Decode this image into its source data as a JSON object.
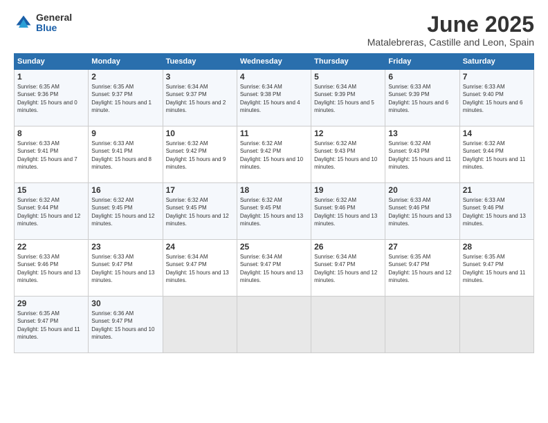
{
  "header": {
    "logo_general": "General",
    "logo_blue": "Blue",
    "title": "June 2025",
    "subtitle": "Matalebreras, Castille and Leon, Spain"
  },
  "calendar": {
    "days_of_week": [
      "Sunday",
      "Monday",
      "Tuesday",
      "Wednesday",
      "Thursday",
      "Friday",
      "Saturday"
    ],
    "weeks": [
      [
        null,
        null,
        null,
        null,
        null,
        null,
        {
          "day": 1,
          "sunrise": "6:35 AM",
          "sunset": "9:36 PM",
          "daylight": "15 hours and 0 minutes."
        },
        {
          "day": 2,
          "sunrise": "6:35 AM",
          "sunset": "9:37 PM",
          "daylight": "15 hours and 1 minute."
        },
        {
          "day": 3,
          "sunrise": "6:34 AM",
          "sunset": "9:37 PM",
          "daylight": "15 hours and 2 minutes."
        },
        {
          "day": 4,
          "sunrise": "6:34 AM",
          "sunset": "9:38 PM",
          "daylight": "15 hours and 4 minutes."
        },
        {
          "day": 5,
          "sunrise": "6:34 AM",
          "sunset": "9:39 PM",
          "daylight": "15 hours and 5 minutes."
        },
        {
          "day": 6,
          "sunrise": "6:33 AM",
          "sunset": "9:39 PM",
          "daylight": "15 hours and 6 minutes."
        },
        {
          "day": 7,
          "sunrise": "6:33 AM",
          "sunset": "9:40 PM",
          "daylight": "15 hours and 6 minutes."
        }
      ],
      [
        {
          "day": 8,
          "sunrise": "6:33 AM",
          "sunset": "9:41 PM",
          "daylight": "15 hours and 7 minutes."
        },
        {
          "day": 9,
          "sunrise": "6:33 AM",
          "sunset": "9:41 PM",
          "daylight": "15 hours and 8 minutes."
        },
        {
          "day": 10,
          "sunrise": "6:32 AM",
          "sunset": "9:42 PM",
          "daylight": "15 hours and 9 minutes."
        },
        {
          "day": 11,
          "sunrise": "6:32 AM",
          "sunset": "9:42 PM",
          "daylight": "15 hours and 10 minutes."
        },
        {
          "day": 12,
          "sunrise": "6:32 AM",
          "sunset": "9:43 PM",
          "daylight": "15 hours and 10 minutes."
        },
        {
          "day": 13,
          "sunrise": "6:32 AM",
          "sunset": "9:43 PM",
          "daylight": "15 hours and 11 minutes."
        },
        {
          "day": 14,
          "sunrise": "6:32 AM",
          "sunset": "9:44 PM",
          "daylight": "15 hours and 11 minutes."
        }
      ],
      [
        {
          "day": 15,
          "sunrise": "6:32 AM",
          "sunset": "9:44 PM",
          "daylight": "15 hours and 12 minutes."
        },
        {
          "day": 16,
          "sunrise": "6:32 AM",
          "sunset": "9:45 PM",
          "daylight": "15 hours and 12 minutes."
        },
        {
          "day": 17,
          "sunrise": "6:32 AM",
          "sunset": "9:45 PM",
          "daylight": "15 hours and 12 minutes."
        },
        {
          "day": 18,
          "sunrise": "6:32 AM",
          "sunset": "9:45 PM",
          "daylight": "15 hours and 13 minutes."
        },
        {
          "day": 19,
          "sunrise": "6:32 AM",
          "sunset": "9:46 PM",
          "daylight": "15 hours and 13 minutes."
        },
        {
          "day": 20,
          "sunrise": "6:33 AM",
          "sunset": "9:46 PM",
          "daylight": "15 hours and 13 minutes."
        },
        {
          "day": 21,
          "sunrise": "6:33 AM",
          "sunset": "9:46 PM",
          "daylight": "15 hours and 13 minutes."
        }
      ],
      [
        {
          "day": 22,
          "sunrise": "6:33 AM",
          "sunset": "9:46 PM",
          "daylight": "15 hours and 13 minutes."
        },
        {
          "day": 23,
          "sunrise": "6:33 AM",
          "sunset": "9:47 PM",
          "daylight": "15 hours and 13 minutes."
        },
        {
          "day": 24,
          "sunrise": "6:34 AM",
          "sunset": "9:47 PM",
          "daylight": "15 hours and 13 minutes."
        },
        {
          "day": 25,
          "sunrise": "6:34 AM",
          "sunset": "9:47 PM",
          "daylight": "15 hours and 13 minutes."
        },
        {
          "day": 26,
          "sunrise": "6:34 AM",
          "sunset": "9:47 PM",
          "daylight": "15 hours and 12 minutes."
        },
        {
          "day": 27,
          "sunrise": "6:35 AM",
          "sunset": "9:47 PM",
          "daylight": "15 hours and 12 minutes."
        },
        {
          "day": 28,
          "sunrise": "6:35 AM",
          "sunset": "9:47 PM",
          "daylight": "15 hours and 11 minutes."
        }
      ],
      [
        {
          "day": 29,
          "sunrise": "6:35 AM",
          "sunset": "9:47 PM",
          "daylight": "15 hours and 11 minutes."
        },
        {
          "day": 30,
          "sunrise": "6:36 AM",
          "sunset": "9:47 PM",
          "daylight": "15 hours and 10 minutes."
        },
        null,
        null,
        null,
        null,
        null
      ]
    ]
  }
}
